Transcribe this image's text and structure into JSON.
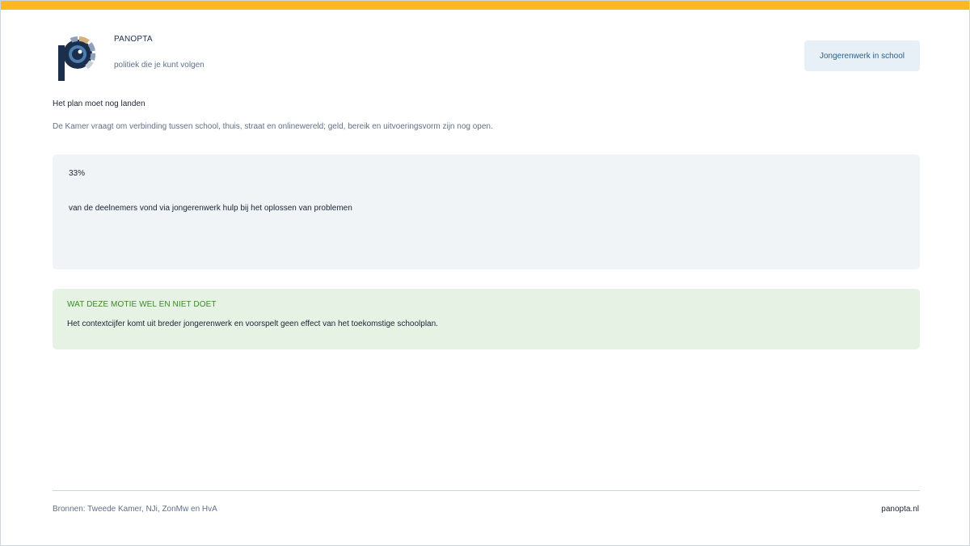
{
  "brand": {
    "name": "PANOPTA",
    "tagline": "politiek die je kunt volgen"
  },
  "topic_badge": "Jongerenwerk in school",
  "main": {
    "heading": "Het plan moet nog landen",
    "subtext": "De Kamer vraagt om verbinding tussen school, thuis, straat en onlinewereld; geld, bereik en uitvoeringsvorm zijn nog open."
  },
  "stat": {
    "value": "33%",
    "description": "van de deelnemers vond via jongerenwerk hulp bij het oplossen van problemen"
  },
  "note": {
    "title": "WAT DEZE MOTIE WEL EN NIET DOET",
    "text": "Het contextcijfer komt uit breder jongerenwerk en voorspelt geen effect van het toekomstige schoolplan."
  },
  "footer": {
    "sources": "Bronnen: Tweede Kamer, NJi, ZonMw en HvA",
    "site": "panopta.nl"
  },
  "colors": {
    "accent_bar": "#fbb81f",
    "logo_navy": "#1b2e4b",
    "logo_blue": "#4a7fb0",
    "logo_tan": "#d2b27a",
    "logo_grey": "#8ea1b8",
    "note_green": "#3b8a2a"
  },
  "icons": {
    "logo": "panopta-eye-logo"
  }
}
